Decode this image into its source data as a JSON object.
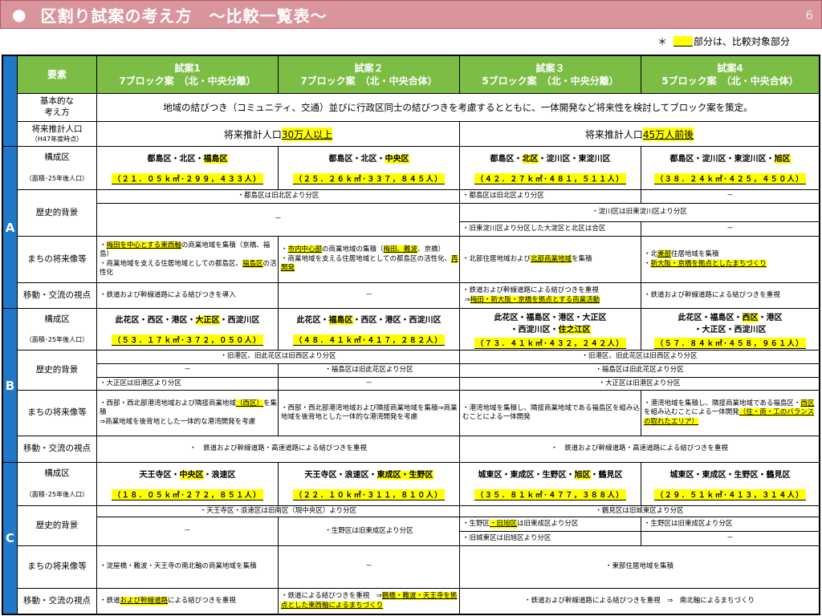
{
  "page": {
    "bullet": "●",
    "title": "区割り試案の考え方　～比較一覧表～",
    "page_number": "6",
    "note_mark": "＊",
    "note_text": "部分は、比較対象部分"
  },
  "header": {
    "label": "要素",
    "plans": [
      {
        "title": "試案1",
        "subtitle": "7ブロック案　（北・中央分離）"
      },
      {
        "title": "試案２",
        "subtitle": "7ブロック案　（北・中央合体）"
      },
      {
        "title": "試案３",
        "subtitle": "5ブロック案　（北・中央分離）"
      },
      {
        "title": "試案4",
        "subtitle": "5ブロック案　（北・中央合体）"
      }
    ]
  },
  "basic": {
    "label_1": "基本的な",
    "label_2": "考え方",
    "text": "地域の結びつき（コミュニティ、交通）並びに行政区同士の結びつきを考慮するとともに、一体開発など将来性を検討してブロック案を策定。"
  },
  "population": {
    "label_1": "将来推計人口",
    "label_2": "（H47年度時点）",
    "seven_prefix": "将来推計人口",
    "seven_value": "30万人以上",
    "five_prefix": "将来推計人口",
    "five_value": "45万人前後"
  },
  "row_labels": {
    "wards": "構成区",
    "wards_sub": "（面積･25年後人口）",
    "history": "歴史的背景",
    "future": "まちの将来像等",
    "mobility": "移動・交流の視点"
  },
  "group_a": {
    "letter": "A",
    "wards": [
      {
        "pre": "都島区・北区・",
        "hl": "福島区",
        "post": "",
        "area": "（２１．０５ｋ㎡･２９９，４３３人）"
      },
      {
        "pre": "都島区・北区・",
        "hl": "中央区",
        "post": "",
        "area": "（２５．２６ｋ㎡･３３７，８４５人）"
      },
      {
        "pre": "都島区・",
        "hl": "北区",
        "post": "・淀川区・東淀川区",
        "area": "（４２．２７ｋ㎡･４８１，５１１人）"
      },
      {
        "pre": "都島区・淀川区・東淀川区・",
        "hl": "旭区",
        "post": "",
        "area": "（３８．２４ｋ㎡･４２５，４５０人）"
      }
    ],
    "history": {
      "r1_12": "・都島区は旧北区より分区",
      "r1_3": "・都島区は旧北区より分区",
      "r1_4": "－",
      "r2_12": "－",
      "r2_34": "・淀川区は旧東淀川区より分区",
      "r3_3": "・旧東淀川区より分区した大淀区と北区は合区",
      "r3_4": "－"
    },
    "future": {
      "p1_a_hl": "梅田を中心とする東西軸",
      "p1_a_post": "の商業地域を集積（京橋、福島）",
      "p1_b_pre": "・商業地域を支える住居地域としての都島区、",
      "p1_b_hl": "福島区",
      "p1_b_post": "の活性化",
      "p2_a_hl": "市内中心部",
      "p2_a_mid": "の商業地域の集積（",
      "p2_a_hl2": "梅田、難波",
      "p2_a_post": "、京橋）",
      "p2_b_pre": "・商業地域を支える住居地域としての都島区の活性化、",
      "p2_b_hl": "再開発",
      "p3_pre": "・北部住居地域および",
      "p3_hl": "北部商業地域",
      "p3_post": "を集積",
      "p4_a_pre": "・北",
      "p4_a_hl": "東部",
      "p4_a_post": "住居地域を集積",
      "p4_b_hl": "新大阪・京橋を拠点としたまちづくり"
    },
    "mobility": {
      "p1": "・鉄道および幹線道路による結びつきを導入",
      "p2": "－",
      "p3_a": "・鉄道および幹線道路による結びつきを重視",
      "p3_b_pre": "⇒",
      "p3_b_hl": "梅田・新大阪・京橋を拠点とする商業活動",
      "p4": "・鉄道および幹線道路による結びつきを重視"
    }
  },
  "group_b": {
    "letter": "B",
    "wards": [
      {
        "pre": "此花区・西区・港区・",
        "hl": "大正区",
        "post": "・西淀川区",
        "area": "（５３．１７ｋ㎡･３７２，０５０人）"
      },
      {
        "pre": "此花区・",
        "hl": "福島区",
        "post": "・西区・港区・西淀川区",
        "area": "（４８．４１ｋ㎡･４１７，２８２人）"
      },
      {
        "pre": "此花区・福島区・港区・大正区",
        "pre2": "・西淀川区・",
        "hl": "住之江区",
        "post": "",
        "area": "（７３．４１ｋ㎡･４３２，２４２人）"
      },
      {
        "pre": "此花区・福島区・",
        "hl": "西区",
        "post": "・港区",
        "line2": "・大正区・西淀川区",
        "area": "（５７．８４ｋ㎡･４５８，９６１人）"
      }
    ],
    "history": {
      "r1_12": "・旧港区、旧此花区は旧西区より分区",
      "r1_34": "・旧港区、旧此花区は旧西区より分区",
      "r2_1": "－",
      "r2_2": "・福島区は旧此花区より分区",
      "r2_34": "・福島区は旧此花区より分区",
      "r3_1": "・大正区は旧港区より分区",
      "r3_2": "－",
      "r3_34": "・大正区は旧港区より分区"
    },
    "future": {
      "p1_a_pre": "・西部・西北部港湾地域および隣接商業地域",
      "p1_a_hl": "（西区）",
      "p1_a_post": "を集積",
      "p1_b": "⇒商業地域を後背地とした一体的な港湾開発を考慮",
      "p2": "・西部・西北部港湾地域および隣接商業地域を集積⇒商業地域を後背地とした一体的な港湾開発を考慮",
      "p3": "・港湾地域を集積し、隣接商業地域である福島区を組み込むことによる一体開発",
      "p4_pre": "・港湾地域を集積し、隣接商業地域である福島区・",
      "p4_hl": "西区",
      "p4_mid": "を組み込むことによる一体開発",
      "p4_hl2": "（住・商・工のバランスの取れたエリア）"
    },
    "mobility": {
      "left": "・　鉄道および幹線道路・高速道路による結びつきを重視",
      "right": "・　鉄道および幹線道路・高速道路による結びつきを重視"
    }
  },
  "group_c": {
    "letter": "C",
    "wards": [
      {
        "pre": "天王寺区・",
        "hl": "中央区",
        "post": "・浪速区",
        "area": "（１８．０５ｋ㎡･２７２，８５１人）"
      },
      {
        "pre": "天王寺区・浪速区・",
        "hl": "東成区・生野区",
        "post": "",
        "area": "（２２．１０ｋ㎡･３１１，８１０人）"
      },
      {
        "pre": "城東区・東成区・生野区・",
        "hl": "旭区",
        "post": "・鶴見区",
        "area": "（３５．８１ｋ㎡･４７７，３８８人）"
      },
      {
        "pre": "城東区・東成区・生野区・鶴見区",
        "hl": "",
        "post": "",
        "area": "（２９．５１ｋ㎡･４１３，３１４人）"
      }
    ],
    "history": {
      "r1_12": "・天王寺区・浪速区は旧南区（現中央区）より分区",
      "r1_34": "・鶴見区は旧城東区より分区",
      "r2_1": "－",
      "r2_2": "・生野区は旧東成区より分区",
      "r2_3_pre": "・生野区",
      "r2_3_hl": "・旧旭区",
      "r2_3_post": "は旧東成区より分区",
      "r2_4": "・生野区は旧東成区より分区",
      "r3_3": "・旧城東区は旧旭区より分区",
      "r3_4": "－"
    },
    "future": {
      "p1": "・淀屋橋・難波・天王寺の南北軸の商業地域を集積",
      "p2": "－",
      "p34": "・東部住居地域を集積"
    },
    "mobility": {
      "p1_pre": "・鉄道",
      "p1_hl": "および幹線道路",
      "p1_post": "による結びつきを重視",
      "p2_pre": "・鉄道による結びつきを重視　⇒",
      "p2_hl": "鶴橋・難波・天王寺を拠点とした東西軸によるまちづくり",
      "p34": "・鉄道および幹線道路による結びつきを重視　⇒　南北軸によるまちづくり"
    }
  },
  "colors": {
    "title_bg": "#d9959b",
    "header_green": "#7cbd45",
    "group_blue": "#1f78c8",
    "highlight": "#ffff00"
  }
}
